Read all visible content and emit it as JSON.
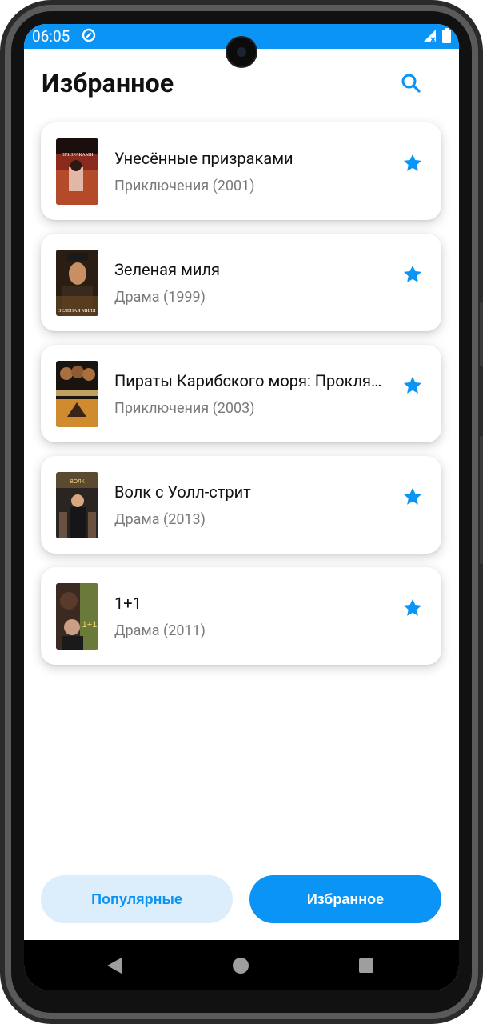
{
  "status_bar": {
    "time": "06:05"
  },
  "header": {
    "title": "Избранное"
  },
  "movies": [
    {
      "title": "Унесённые призраками",
      "subtitle": "Приключения (2001)",
      "poster_text": "ПРИЗРАКАМИ"
    },
    {
      "title": "Зеленая миля",
      "subtitle": "Драма (1999)",
      "poster_text": "ЗЕЛЕНАЯ МИЛЯ"
    },
    {
      "title": "Пираты Карибского моря: Проклятие Черной жемчужины",
      "subtitle": "Приключения (2003)",
      "poster_text": ""
    },
    {
      "title": "Волк с Уолл-стрит",
      "subtitle": "Драма (2013)",
      "poster_text": "ВОЛК"
    },
    {
      "title": "1+1",
      "subtitle": "Драма (2011)",
      "poster_text": "1+1"
    }
  ],
  "bottom_nav": {
    "popular_label": "Популярные",
    "favorites_label": "Избранное"
  },
  "colors": {
    "accent": "#0a94f5",
    "accent_light": "#dcedfc"
  }
}
